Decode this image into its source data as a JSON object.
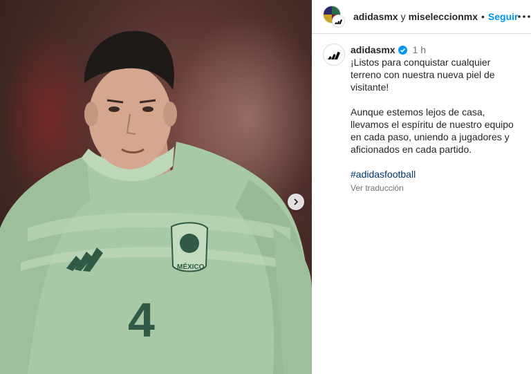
{
  "header": {
    "account1": "adidasmx",
    "joiner": "y",
    "account2": "miseleccionmx",
    "separator": "•",
    "follow_label": "Seguir",
    "more_icon": "more-horizontal-icon"
  },
  "caption": {
    "username": "adidasmx",
    "verified_icon": "verified-badge-icon",
    "time": "1 h",
    "paragraph1": "¡Listos para conquistar cualquier terreno con nuestra nueva piel de visitante!",
    "paragraph2": "Aunque estemos lejos de casa, llevamos el espíritu de nuestro equipo en cada paso, uniendo a jugadores y aficionados en cada partido.",
    "hashtag": "#adidasfootball",
    "translate_label": "Ver traducción"
  },
  "media": {
    "jersey_number": "4",
    "crest_text": "MÉXICO",
    "next_icon": "chevron-right-icon"
  },
  "colors": {
    "follow_blue": "#0095f6",
    "verified_blue": "#0095f6",
    "hashtag_blue": "#00376b",
    "jersey_green": "#a8c9a6"
  }
}
